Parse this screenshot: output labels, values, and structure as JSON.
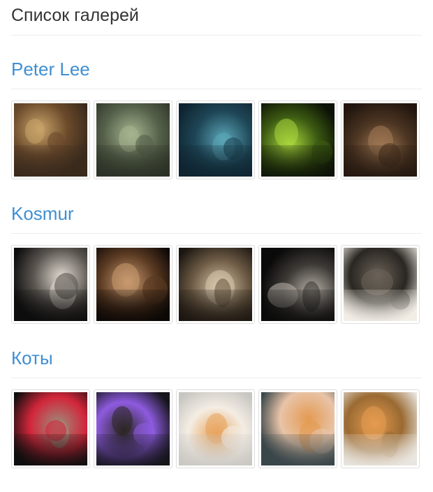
{
  "page_title": "Список галерей",
  "galleries": [
    {
      "title": "Peter Lee",
      "images": [
        {
          "icon": "scifi-corridor-image",
          "colors": [
            "#3a2a1c",
            "#c9a46a",
            "#6b4a2b"
          ]
        },
        {
          "icon": "scifi-hall-image",
          "colors": [
            "#2c3226",
            "#a7b48f",
            "#55604a"
          ]
        },
        {
          "icon": "lab-tanks-image",
          "colors": [
            "#0f2430",
            "#5ba6b8",
            "#1e4656"
          ]
        },
        {
          "icon": "alien-spiral-image",
          "colors": [
            "#0c1206",
            "#a8d63c",
            "#3c5a12"
          ]
        },
        {
          "icon": "industrial-interior-image",
          "colors": [
            "#22160f",
            "#a27a55",
            "#4c3522"
          ]
        }
      ]
    },
    {
      "title": "Kosmur",
      "images": [
        {
          "icon": "mask-face-image",
          "colors": [
            "#0d0d0d",
            "#e2dbd2",
            "#5a5550"
          ]
        },
        {
          "icon": "bald-figure-image",
          "colors": [
            "#0b0705",
            "#c99a70",
            "#5a3a22"
          ]
        },
        {
          "icon": "glasses-portrait-image",
          "colors": [
            "#1a1510",
            "#d9c9ad",
            "#6c5a44"
          ]
        },
        {
          "icon": "masked-man-image",
          "colors": [
            "#0a0a0a",
            "#bdb6ad",
            "#3e3a36"
          ]
        },
        {
          "icon": "machine-figure-image",
          "colors": [
            "#f2eee6",
            "#6a6258",
            "#2a2622"
          ]
        }
      ]
    },
    {
      "title": "Коты",
      "images": [
        {
          "icon": "kittens-basket-image",
          "colors": [
            "#0e0e0e",
            "#9c8f7e",
            "#d2263a"
          ]
        },
        {
          "icon": "black-cat-slinky-image",
          "colors": [
            "#15151a",
            "#2b2623",
            "#8e5be0"
          ]
        },
        {
          "icon": "ginger-kittens-image",
          "colors": [
            "#c8c6c2",
            "#e8a25a",
            "#f4ede4"
          ]
        },
        {
          "icon": "kittens-in-hands-image",
          "colors": [
            "#39464a",
            "#e49a52",
            "#e8c4a8"
          ]
        },
        {
          "icon": "kittens-wicker-basket-image",
          "colors": [
            "#e9e6e0",
            "#e59b50",
            "#9a6a32"
          ]
        }
      ]
    }
  ]
}
